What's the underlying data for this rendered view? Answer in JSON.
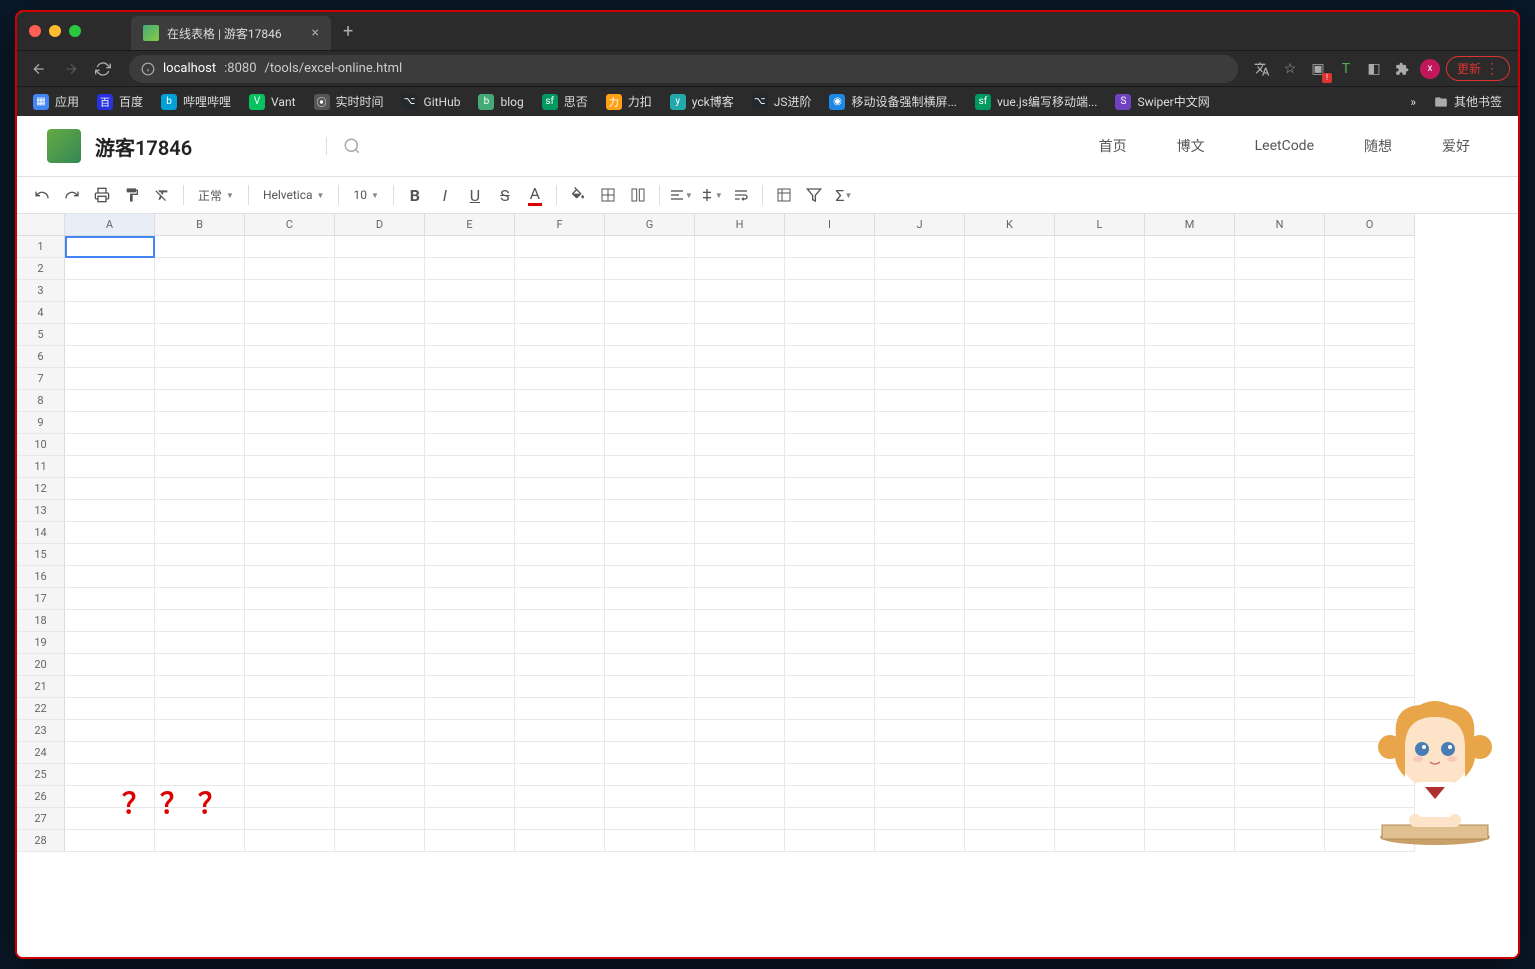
{
  "browser": {
    "tab_title": "在线表格 | 游客17846",
    "url_host": "localhost",
    "url_port": ":8080",
    "url_path": "/tools/excel-online.html",
    "update_label": "更新",
    "bookmarks": [
      {
        "label": "应用",
        "color": "#4285f4"
      },
      {
        "label": "百度",
        "color": "#2932e1"
      },
      {
        "label": "哔哩哔哩",
        "color": "#00a1d6"
      },
      {
        "label": "Vant",
        "color": "#07c160"
      },
      {
        "label": "实时时间",
        "color": "#555"
      },
      {
        "label": "GitHub",
        "color": "#24292e"
      },
      {
        "label": "blog",
        "color": "#4a7"
      },
      {
        "label": "思否",
        "color": "#009a61"
      },
      {
        "label": "力扣",
        "color": "#ffa116"
      },
      {
        "label": "yck博客",
        "color": "#2aa"
      },
      {
        "label": "JS进阶",
        "color": "#24292e"
      },
      {
        "label": "移动设备强制横屏...",
        "color": "#1e88e5"
      },
      {
        "label": "vue.js编写移动端...",
        "color": "#009a61"
      },
      {
        "label": "Swiper中文网",
        "color": "#6f42c1"
      }
    ],
    "other_bookmarks": "其他书签",
    "overflow": "»"
  },
  "page_header": {
    "title": "游客17846",
    "nav": [
      "首页",
      "博文",
      "LeetCode",
      "随想",
      "爱好"
    ]
  },
  "toolbar": {
    "format_label": "正常",
    "font_label": "Helvetica",
    "size_label": "10"
  },
  "sheet": {
    "columns": [
      "A",
      "B",
      "C",
      "D",
      "E",
      "F",
      "G",
      "H",
      "I",
      "J",
      "K",
      "L",
      "M",
      "N",
      "O"
    ],
    "row_count": 28,
    "active_cell": "A1"
  },
  "annotation": "？？？"
}
